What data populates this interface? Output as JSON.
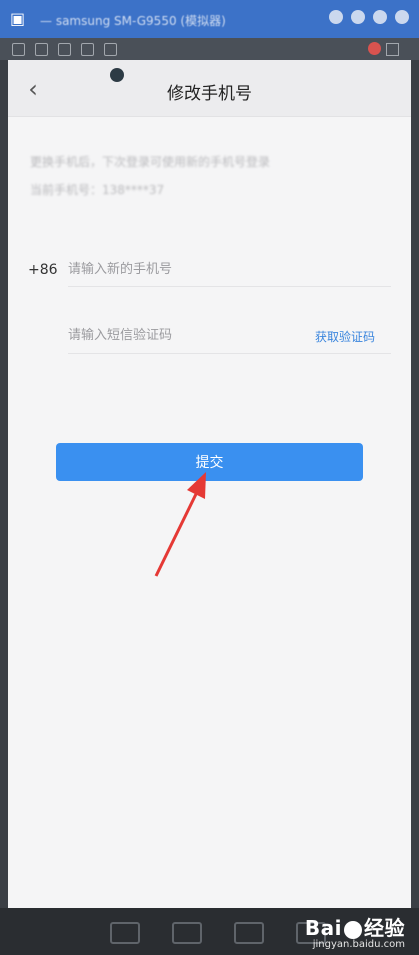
{
  "window": {
    "title": "— samsung SM-G9550 (模拟器)",
    "app_icon": "phone-mirror-icon"
  },
  "nav": {
    "back_icon": "chevron-left-icon",
    "title": "修改手机号"
  },
  "info": {
    "line1": "更换手机后，下次登录可使用新的手机号登录",
    "line2": "当前手机号：138****37"
  },
  "form": {
    "country_code": "+86",
    "phone_placeholder": "请输入新的手机号",
    "phone_value": "",
    "code_placeholder": "请输入短信验证码",
    "code_value": "",
    "get_code_label": "获取验证码"
  },
  "submit": {
    "label": "提交"
  },
  "watermark": {
    "main": "Bai",
    "main_cn": "经验",
    "sub": "jingyan.baidu.com"
  },
  "colors": {
    "accent": "#3a90f0",
    "link": "#3a85dd",
    "title_bar": "#3c72c8",
    "annotation_arrow": "#e53935"
  }
}
